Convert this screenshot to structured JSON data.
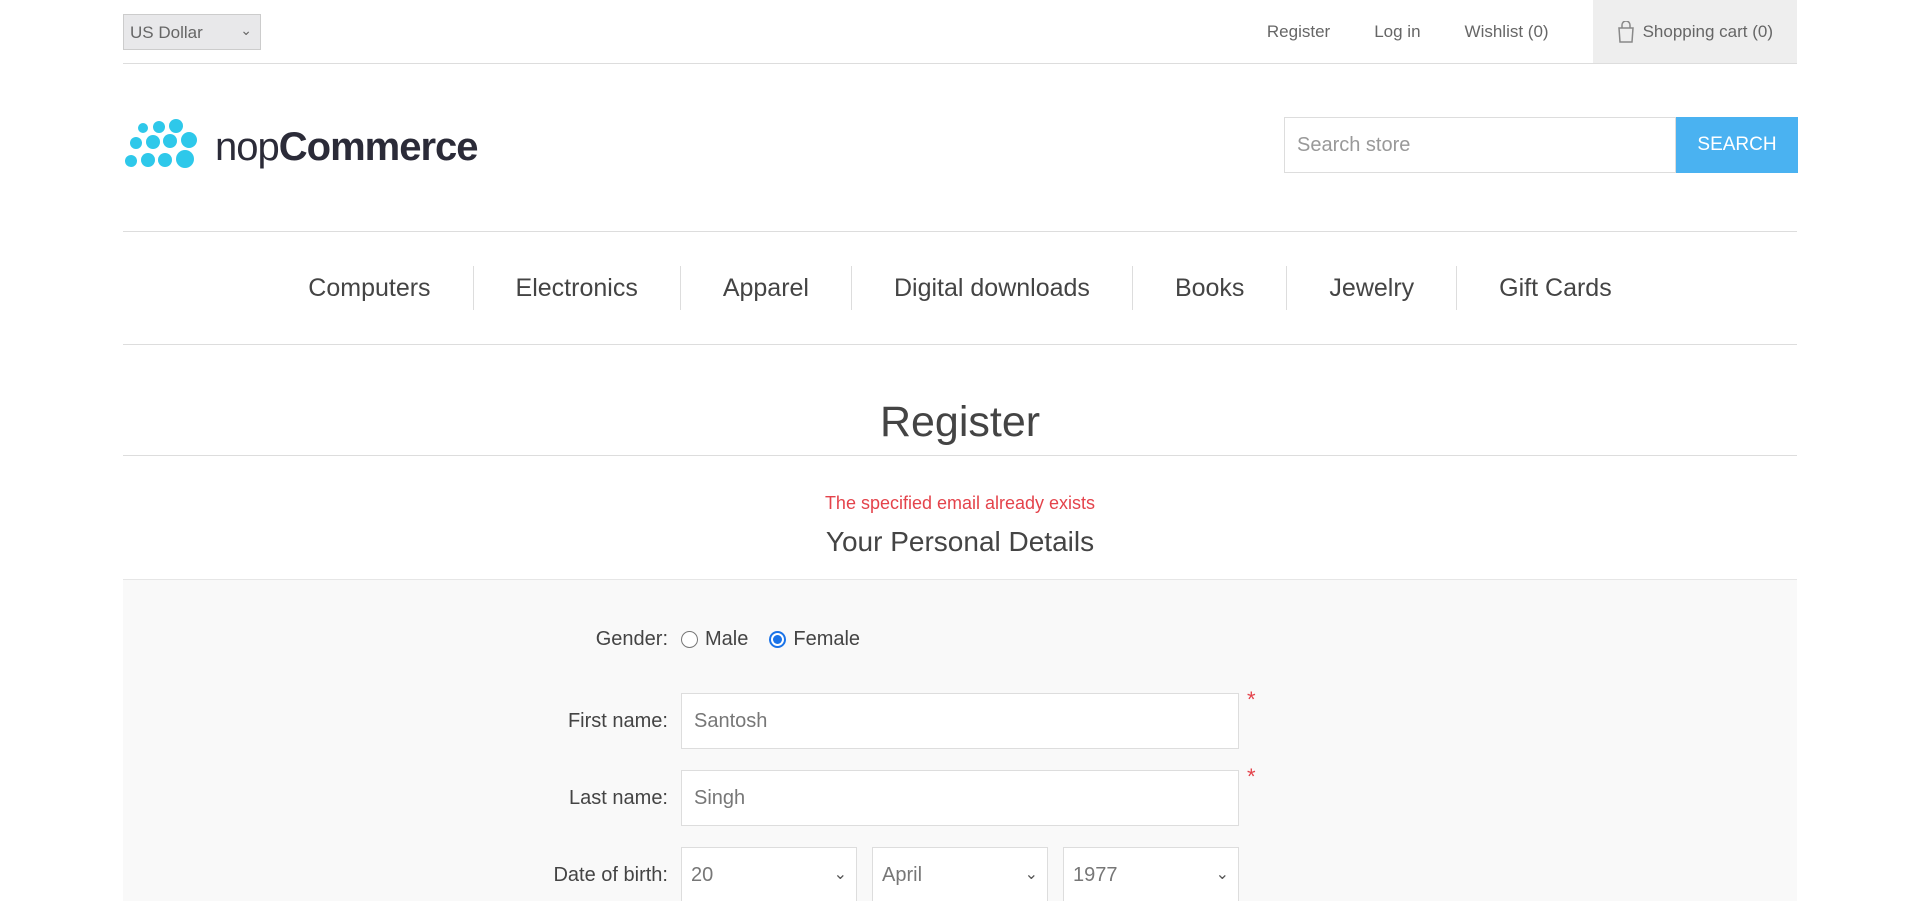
{
  "header": {
    "currency": "US Dollar",
    "links": {
      "register": "Register",
      "login": "Log in",
      "wishlist": "Wishlist (0)",
      "cart": "Shopping cart (0)"
    }
  },
  "logo": {
    "text_light": "nop",
    "text_bold": "Commerce",
    "color": "#2ec8ea"
  },
  "search": {
    "placeholder": "Search store",
    "button": "SEARCH"
  },
  "nav": [
    "Computers",
    "Electronics",
    "Apparel",
    "Digital downloads",
    "Books",
    "Jewelry",
    "Gift Cards"
  ],
  "page": {
    "title": "Register",
    "error": "The specified email already exists",
    "section_title": "Your Personal Details"
  },
  "form": {
    "gender_label": "Gender:",
    "gender_options": [
      "Male",
      "Female"
    ],
    "gender_selected": "Female",
    "first_name_label": "First name:",
    "first_name_value": "Santosh",
    "last_name_label": "Last name:",
    "last_name_value": "Singh",
    "dob_label": "Date of birth:",
    "dob_day": "20",
    "dob_month": "April",
    "dob_year": "1977",
    "required_mark": "*"
  },
  "colors": {
    "accent": "#4ab2f1",
    "error": "#e4434b",
    "radio_selected": "#1a73e8"
  }
}
